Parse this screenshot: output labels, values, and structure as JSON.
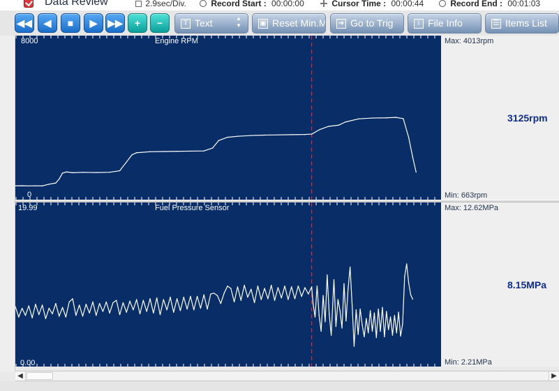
{
  "topbar": {
    "title": "Data Review",
    "time_div": "2.9sec/Div.",
    "record_start_label": "Record Start :",
    "record_start_value": "00:00:00",
    "cursor_time_label": "Cursor Time :",
    "cursor_time_value": "00:00:44",
    "record_end_label": "Record End :",
    "record_end_value": "00:01:03"
  },
  "toolbar": {
    "buttons": [
      {
        "name": "rewind-button",
        "icon": "rewind-icon",
        "symbol": "◀◀"
      },
      {
        "name": "prev-button",
        "icon": "prev-icon",
        "symbol": "◀"
      },
      {
        "name": "stop-button",
        "icon": "stop-icon",
        "symbol": "■"
      },
      {
        "name": "play-button",
        "icon": "play-icon",
        "symbol": "▶"
      },
      {
        "name": "fast-forward-button",
        "icon": "fast-forward-icon",
        "symbol": "▶▶"
      },
      {
        "name": "zoom-in-button",
        "icon": "plus-icon",
        "symbol": "+"
      },
      {
        "name": "zoom-out-button",
        "icon": "minus-icon",
        "symbol": "−"
      }
    ],
    "text_button": "Text",
    "reset_button": "Reset Min.Max.",
    "go_to_trig_button": "Go to Trig",
    "file_info_button": "File Info",
    "items_list_button": "Items List",
    "text_icon": "T",
    "reset_icon": "▣",
    "go_icon": "➜",
    "info_icon": "i",
    "list_icon": "☰"
  },
  "colors": {
    "plot_bg": "#082d67",
    "trace": "#ffffff",
    "cursor": "#ff2a2a",
    "accent_value": "#0e2c8f"
  },
  "charts": [
    {
      "chart_data": {
        "type": "line",
        "title": "Engine RPM",
        "y_top_label": "8000",
        "y_bottom_label": "0",
        "max_label": "Max:  4013rpm",
        "min_label": "Min:    663rpm",
        "current_value": "3125rpm",
        "xlim": [
          0,
          63
        ],
        "ylim": [
          0,
          8000
        ],
        "cursor_x": 44,
        "series": [
          {
            "values": [
              {
                "x": 0,
                "y": 560
              },
              {
                "x": 1.0,
                "y": 565
              },
              {
                "x": 2.0,
                "y": 558
              },
              {
                "x": 3.0,
                "y": 562
              },
              {
                "x": 4.0,
                "y": 555
              },
              {
                "x": 5.0,
                "y": 640
              },
              {
                "x": 6.0,
                "y": 700
              },
              {
                "x": 6.5,
                "y": 900
              },
              {
                "x": 7.0,
                "y": 1200
              },
              {
                "x": 7.6,
                "y": 1260
              },
              {
                "x": 8.5,
                "y": 1220
              },
              {
                "x": 10.0,
                "y": 1240
              },
              {
                "x": 12.0,
                "y": 1230
              },
              {
                "x": 14.0,
                "y": 1245
              },
              {
                "x": 15.5,
                "y": 1320
              },
              {
                "x": 16.5,
                "y": 1760
              },
              {
                "x": 17.3,
                "y": 2120
              },
              {
                "x": 18.0,
                "y": 2230
              },
              {
                "x": 20.0,
                "y": 2280
              },
              {
                "x": 22.0,
                "y": 2290
              },
              {
                "x": 24.0,
                "y": 2300
              },
              {
                "x": 26.0,
                "y": 2310
              },
              {
                "x": 28.0,
                "y": 2320
              },
              {
                "x": 29.3,
                "y": 2470
              },
              {
                "x": 30.2,
                "y": 2850
              },
              {
                "x": 31.5,
                "y": 3010
              },
              {
                "x": 33.0,
                "y": 3060
              },
              {
                "x": 35.0,
                "y": 3100
              },
              {
                "x": 37.0,
                "y": 3120
              },
              {
                "x": 39.0,
                "y": 3130
              },
              {
                "x": 41.0,
                "y": 3140
              },
              {
                "x": 43.0,
                "y": 3150
              },
              {
                "x": 44.0,
                "y": 3170
              },
              {
                "x": 45.2,
                "y": 3400
              },
              {
                "x": 46.5,
                "y": 3560
              },
              {
                "x": 48.0,
                "y": 3620
              },
              {
                "x": 49.0,
                "y": 3780
              },
              {
                "x": 51.0,
                "y": 3940
              },
              {
                "x": 53.0,
                "y": 3980
              },
              {
                "x": 55.0,
                "y": 3990
              },
              {
                "x": 56.5,
                "y": 4013
              },
              {
                "x": 57.6,
                "y": 3950
              },
              {
                "x": 58.4,
                "y": 3000
              },
              {
                "x": 59.0,
                "y": 2000
              },
              {
                "x": 59.5,
                "y": 1250
              }
            ]
          }
        ]
      }
    },
    {
      "chart_data": {
        "type": "line",
        "title": "Fuel Pressure Sensor",
        "y_top_label": "19.99",
        "y_bottom_label": "0.00",
        "max_label": "Max: 12.62MPa",
        "min_label": "Min:   2.21MPa",
        "current_value": "8.15MPa",
        "xlim": [
          0,
          63
        ],
        "ylim": [
          0,
          19.99
        ],
        "cursor_x": 44,
        "series": [
          {
            "values": [
              {
                "x": 0,
                "y": 7.2
              },
              {
                "x": 0.5,
                "y": 5.9
              },
              {
                "x": 1.0,
                "y": 7.0
              },
              {
                "x": 1.5,
                "y": 6.1
              },
              {
                "x": 2.0,
                "y": 7.3
              },
              {
                "x": 2.5,
                "y": 5.8
              },
              {
                "x": 3.0,
                "y": 7.5
              },
              {
                "x": 3.5,
                "y": 6.2
              },
              {
                "x": 4.0,
                "y": 7.4
              },
              {
                "x": 4.5,
                "y": 5.7
              },
              {
                "x": 5.0,
                "y": 7.0
              },
              {
                "x": 5.5,
                "y": 6.3
              },
              {
                "x": 6.0,
                "y": 7.6
              },
              {
                "x": 6.5,
                "y": 6.0
              },
              {
                "x": 7.0,
                "y": 7.1
              },
              {
                "x": 7.5,
                "y": 5.9
              },
              {
                "x": 8.0,
                "y": 7.8
              },
              {
                "x": 8.5,
                "y": 8.2
              },
              {
                "x": 9.0,
                "y": 6.1
              },
              {
                "x": 9.5,
                "y": 7.4
              },
              {
                "x": 10.0,
                "y": 6.0
              },
              {
                "x": 10.5,
                "y": 7.5
              },
              {
                "x": 11.0,
                "y": 6.4
              },
              {
                "x": 11.5,
                "y": 7.8
              },
              {
                "x": 12.0,
                "y": 6.1
              },
              {
                "x": 12.5,
                "y": 7.6
              },
              {
                "x": 13.0,
                "y": 6.6
              },
              {
                "x": 13.5,
                "y": 7.8
              },
              {
                "x": 14.0,
                "y": 6.4
              },
              {
                "x": 14.5,
                "y": 7.7
              },
              {
                "x": 15.0,
                "y": 8.0
              },
              {
                "x": 15.5,
                "y": 6.2
              },
              {
                "x": 16.0,
                "y": 7.7
              },
              {
                "x": 16.5,
                "y": 6.5
              },
              {
                "x": 17.0,
                "y": 7.9
              },
              {
                "x": 17.5,
                "y": 6.8
              },
              {
                "x": 18.0,
                "y": 8.1
              },
              {
                "x": 18.5,
                "y": 6.3
              },
              {
                "x": 19.0,
                "y": 8.0
              },
              {
                "x": 19.5,
                "y": 6.6
              },
              {
                "x": 20.0,
                "y": 8.2
              },
              {
                "x": 20.5,
                "y": 6.4
              },
              {
                "x": 21.0,
                "y": 8.3
              },
              {
                "x": 21.5,
                "y": 6.2
              },
              {
                "x": 22.0,
                "y": 8.1
              },
              {
                "x": 22.5,
                "y": 6.8
              },
              {
                "x": 23.0,
                "y": 8.4
              },
              {
                "x": 23.5,
                "y": 6.5
              },
              {
                "x": 24.0,
                "y": 8.2
              },
              {
                "x": 24.5,
                "y": 6.7
              },
              {
                "x": 25.0,
                "y": 8.4
              },
              {
                "x": 25.5,
                "y": 6.9
              },
              {
                "x": 26.0,
                "y": 8.5
              },
              {
                "x": 26.5,
                "y": 6.8
              },
              {
                "x": 27.0,
                "y": 8.5
              },
              {
                "x": 27.5,
                "y": 7.0
              },
              {
                "x": 28.0,
                "y": 8.7
              },
              {
                "x": 28.5,
                "y": 6.9
              },
              {
                "x": 29.0,
                "y": 8.8
              },
              {
                "x": 29.5,
                "y": 8.9
              },
              {
                "x": 30.0,
                "y": 8.6
              },
              {
                "x": 30.5,
                "y": 7.6
              },
              {
                "x": 31.0,
                "y": 8.9
              },
              {
                "x": 31.5,
                "y": 9.8
              },
              {
                "x": 32.0,
                "y": 9.5
              },
              {
                "x": 32.5,
                "y": 7.8
              },
              {
                "x": 33.0,
                "y": 9.7
              },
              {
                "x": 33.5,
                "y": 8.0
              },
              {
                "x": 34.0,
                "y": 9.9
              },
              {
                "x": 34.5,
                "y": 8.4
              },
              {
                "x": 35.0,
                "y": 9.4
              },
              {
                "x": 35.5,
                "y": 7.7
              },
              {
                "x": 36.0,
                "y": 9.8
              },
              {
                "x": 36.5,
                "y": 8.1
              },
              {
                "x": 37.0,
                "y": 9.5
              },
              {
                "x": 37.5,
                "y": 8.2
              },
              {
                "x": 38.0,
                "y": 9.9
              },
              {
                "x": 38.5,
                "y": 8.0
              },
              {
                "x": 39.0,
                "y": 9.6
              },
              {
                "x": 39.5,
                "y": 8.3
              },
              {
                "x": 40.0,
                "y": 9.8
              },
              {
                "x": 40.5,
                "y": 8.1
              },
              {
                "x": 41.0,
                "y": 9.7
              },
              {
                "x": 41.5,
                "y": 8.2
              },
              {
                "x": 42.0,
                "y": 9.8
              },
              {
                "x": 42.5,
                "y": 8.5
              },
              {
                "x": 43.0,
                "y": 9.6
              },
              {
                "x": 43.5,
                "y": 8.8
              },
              {
                "x": 44.0,
                "y": 9.7
              },
              {
                "x": 44.2,
                "y": 7.6
              },
              {
                "x": 44.5,
                "y": 5.9
              },
              {
                "x": 44.8,
                "y": 9.8
              },
              {
                "x": 45.1,
                "y": 6.1
              },
              {
                "x": 45.4,
                "y": 4.1
              },
              {
                "x": 45.7,
                "y": 8.6
              },
              {
                "x": 46.0,
                "y": 5.3
              },
              {
                "x": 46.3,
                "y": 11.2
              },
              {
                "x": 46.6,
                "y": 6.3
              },
              {
                "x": 46.9,
                "y": 3.6
              },
              {
                "x": 47.3,
                "y": 10.6
              },
              {
                "x": 47.6,
                "y": 4.7
              },
              {
                "x": 47.9,
                "y": 8.1
              },
              {
                "x": 48.2,
                "y": 6.7
              },
              {
                "x": 48.5,
                "y": 4.5
              },
              {
                "x": 48.8,
                "y": 10.1
              },
              {
                "x": 49.1,
                "y": 5.4
              },
              {
                "x": 49.4,
                "y": 9.4
              },
              {
                "x": 49.7,
                "y": 12.2
              },
              {
                "x": 50.0,
                "y": 7.5
              },
              {
                "x": 50.3,
                "y": 2.2
              },
              {
                "x": 50.6,
                "y": 6.8
              },
              {
                "x": 50.9,
                "y": 3.7
              },
              {
                "x": 51.2,
                "y": 6.9
              },
              {
                "x": 51.5,
                "y": 4.9
              },
              {
                "x": 51.8,
                "y": 3.4
              },
              {
                "x": 52.1,
                "y": 5.7
              },
              {
                "x": 52.4,
                "y": 3.9
              },
              {
                "x": 52.7,
                "y": 6.7
              },
              {
                "x": 53.0,
                "y": 4.1
              },
              {
                "x": 53.3,
                "y": 6.4
              },
              {
                "x": 53.6,
                "y": 3.3
              },
              {
                "x": 53.9,
                "y": 6.9
              },
              {
                "x": 54.2,
                "y": 4.1
              },
              {
                "x": 54.5,
                "y": 7.1
              },
              {
                "x": 54.8,
                "y": 3.4
              },
              {
                "x": 55.1,
                "y": 6.6
              },
              {
                "x": 55.4,
                "y": 4.3
              },
              {
                "x": 55.7,
                "y": 5.9
              },
              {
                "x": 56.0,
                "y": 3.6
              },
              {
                "x": 56.3,
                "y": 6.1
              },
              {
                "x": 56.6,
                "y": 3.9
              },
              {
                "x": 56.9,
                "y": 6.5
              },
              {
                "x": 57.2,
                "y": 3.5
              },
              {
                "x": 57.5,
                "y": 5.0
              },
              {
                "x": 57.8,
                "y": 11.0
              },
              {
                "x": 58.1,
                "y": 12.6
              },
              {
                "x": 58.4,
                "y": 10.2
              },
              {
                "x": 58.7,
                "y": 8.7
              },
              {
                "x": 59.0,
                "y": 8.15
              }
            ]
          }
        ]
      }
    }
  ]
}
